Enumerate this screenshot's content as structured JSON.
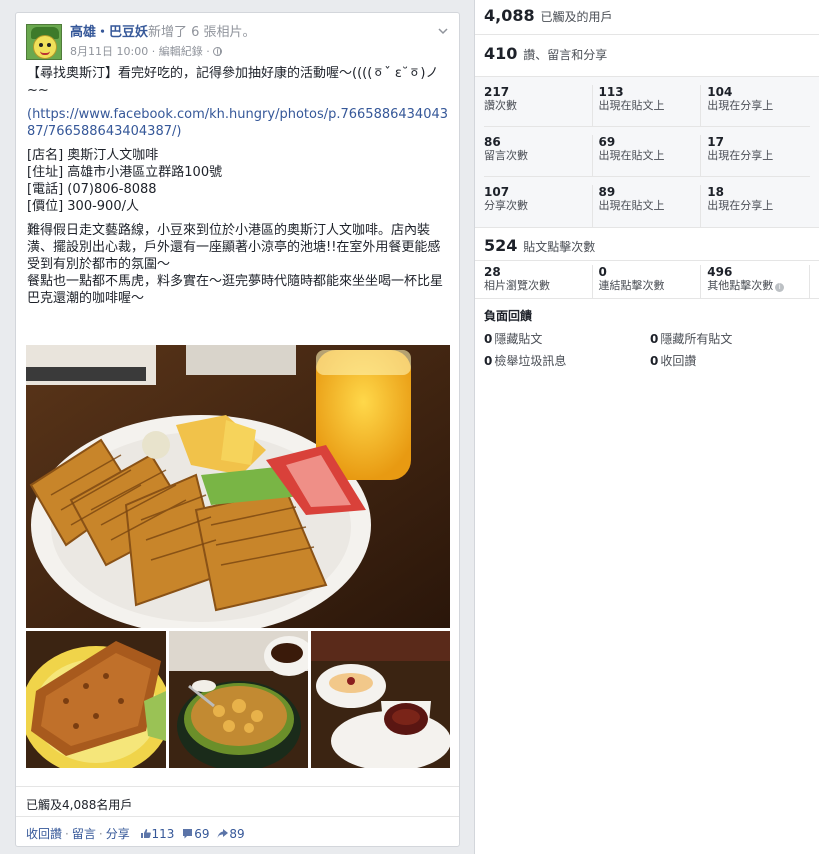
{
  "post": {
    "page_name": "高雄・巴豆妖",
    "action_text": "新增了 6 張相片。",
    "date": "8月11日 10:00",
    "meta_sep": "·",
    "edit_history": "編輯紀錄",
    "body": {
      "line1": "【尋找奧斯汀】看完好吃的，記得參加抽好康的活動喔～((((ㆆˇ ε˘ㆆ)ノ~~",
      "link": "(https://www.facebook.com/kh.hungry/photos/p.766588643404387/766588643404387/)",
      "info": [
        "[店名] 奧斯汀人文咖啡",
        "[住址] 高雄市小港區立群路100號",
        "[電話] (07)806-8088",
        "[價位] 300-900/人"
      ],
      "para1": "難得假日走文藝路線，小豆來到位於小港區的奧斯汀人文咖啡。店內裝潢、擺設別出心裁，戶外還有一座顯著小涼亭的池塘!!在室外用餐更能感受到有別於都市的氛圍～",
      "para2": "餐點也一點都不馬虎，料多實在～逛完夢時代隨時都能來坐坐喝一杯比星巴克還潮的咖啡喔～"
    },
    "reach_text": "已觸及4,088名用戶",
    "actions": {
      "unlike": "收回讚",
      "comment": "留言",
      "share": "分享",
      "likes": "113",
      "comments": "69",
      "shares": "89"
    }
  },
  "insights": {
    "reach": {
      "value": "4,088",
      "label": "已觸及的用戶"
    },
    "engagement": {
      "value": "410",
      "label": "讚、留言和分享"
    },
    "stats": [
      [
        {
          "value": "217",
          "label": "讚次數"
        },
        {
          "value": "113",
          "label": "出現在貼文上"
        },
        {
          "value": "104",
          "label": "出現在分享上"
        }
      ],
      [
        {
          "value": "86",
          "label": "留言次數"
        },
        {
          "value": "69",
          "label": "出現在貼文上"
        },
        {
          "value": "17",
          "label": "出現在分享上"
        }
      ],
      [
        {
          "value": "107",
          "label": "分享次數"
        },
        {
          "value": "89",
          "label": "出現在貼文上"
        },
        {
          "value": "18",
          "label": "出現在分享上"
        }
      ]
    ],
    "clicks": {
      "value": "524",
      "label": "貼文點擊次數"
    },
    "click_breakdown": [
      {
        "value": "28",
        "label": "相片瀏覽次數"
      },
      {
        "value": "0",
        "label": "連結點擊次數"
      },
      {
        "value": "496",
        "label": "其他點擊次數"
      }
    ],
    "negative": {
      "title": "負面回饋",
      "items": [
        {
          "value": "0",
          "label": "隱藏貼文"
        },
        {
          "value": "0",
          "label": "隱藏所有貼文"
        },
        {
          "value": "0",
          "label": "檢舉垃圾訊息"
        },
        {
          "value": "0",
          "label": "收回讚"
        }
      ]
    }
  }
}
